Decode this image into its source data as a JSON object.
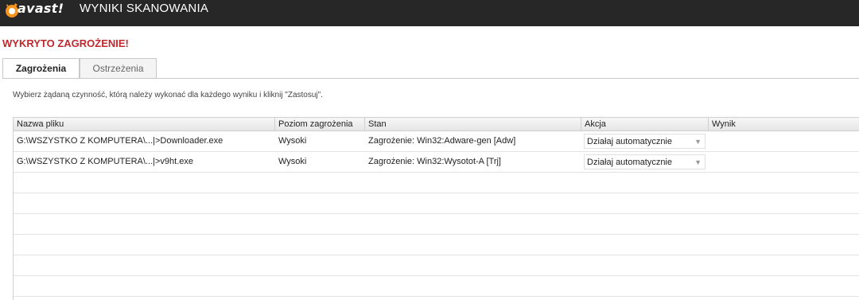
{
  "titlebar": {
    "logo_text": "avast!",
    "title": "WYNIKI SKANOWANIA"
  },
  "alert_title": "WYKRYTO ZAGROŻENIE!",
  "tabs": [
    {
      "label": "Zagrożenia",
      "active": true
    },
    {
      "label": "Ostrzeżenia",
      "active": false
    }
  ],
  "instructions": "Wybierz żądaną czynność, którą należy wykonać dla każdego wyniku i kliknij \"Zastosuj\".",
  "table": {
    "headers": [
      "Nazwa pliku",
      "Poziom zagrożenia",
      "Stan",
      "Akcja",
      "Wynik"
    ],
    "rows": [
      {
        "file": "G:\\WSZYSTKO Z KOMPUTERA\\...|>Downloader.exe",
        "level": "Wysoki",
        "status": "Zagrożenie: Win32:Adware-gen [Adw]",
        "action": "Działaj automatycznie",
        "result": ""
      },
      {
        "file": "G:\\WSZYSTKO Z KOMPUTERA\\...|>v9ht.exe",
        "level": "Wysoki",
        "status": "Zagrożenie: Win32:Wysotot-A [Trj]",
        "action": "Działaj automatycznie",
        "result": ""
      }
    ]
  },
  "colors": {
    "titlebar_bg": "#272727",
    "alert_red": "#c0272d",
    "logo_orange": "#f7941d"
  }
}
